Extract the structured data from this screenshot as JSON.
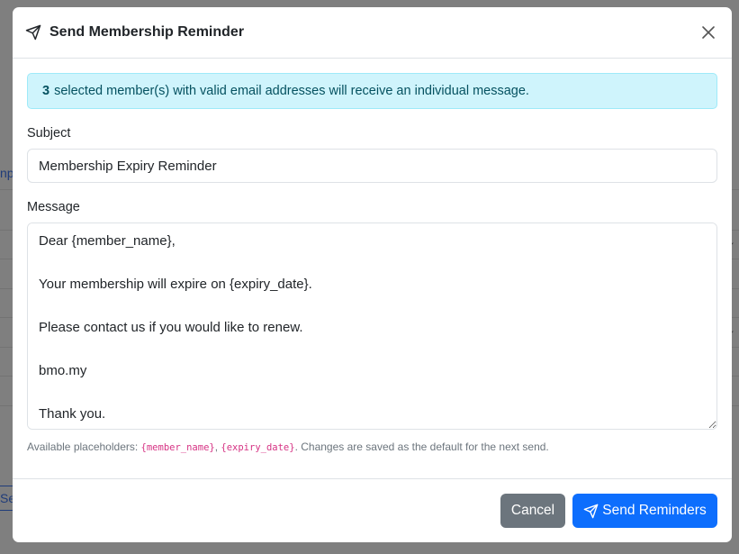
{
  "background": {
    "link_fragment": "np",
    "button_fragment": "Se"
  },
  "modal": {
    "title": "Send Membership Reminder",
    "header_icon": "send-icon",
    "close_icon": "close-icon",
    "alert": {
      "count": "3",
      "text": "selected member(s) with valid email addresses will receive an individual message."
    },
    "subject": {
      "label": "Subject",
      "value": "Membership Expiry Reminder"
    },
    "message": {
      "label": "Message",
      "value": "Dear {member_name},\n\nYour membership will expire on {expiry_date}.\n\nPlease contact us if you would like to renew.\n\nbmo.my\n\nThank you."
    },
    "help": {
      "prefix": "Available placeholders: ",
      "placeholder_1": "{member_name}",
      "separator": ", ",
      "placeholder_2": "{expiry_date}",
      "suffix": ". Changes are saved as the default for the next send."
    },
    "footer": {
      "cancel_label": "Cancel",
      "send_label": "Send Reminders",
      "send_icon": "send-icon"
    }
  },
  "colors": {
    "primary": "#0d6efd",
    "secondary": "#6c757d",
    "alert_bg": "#cff4fc",
    "alert_text": "#055160",
    "code": "#d63384"
  }
}
